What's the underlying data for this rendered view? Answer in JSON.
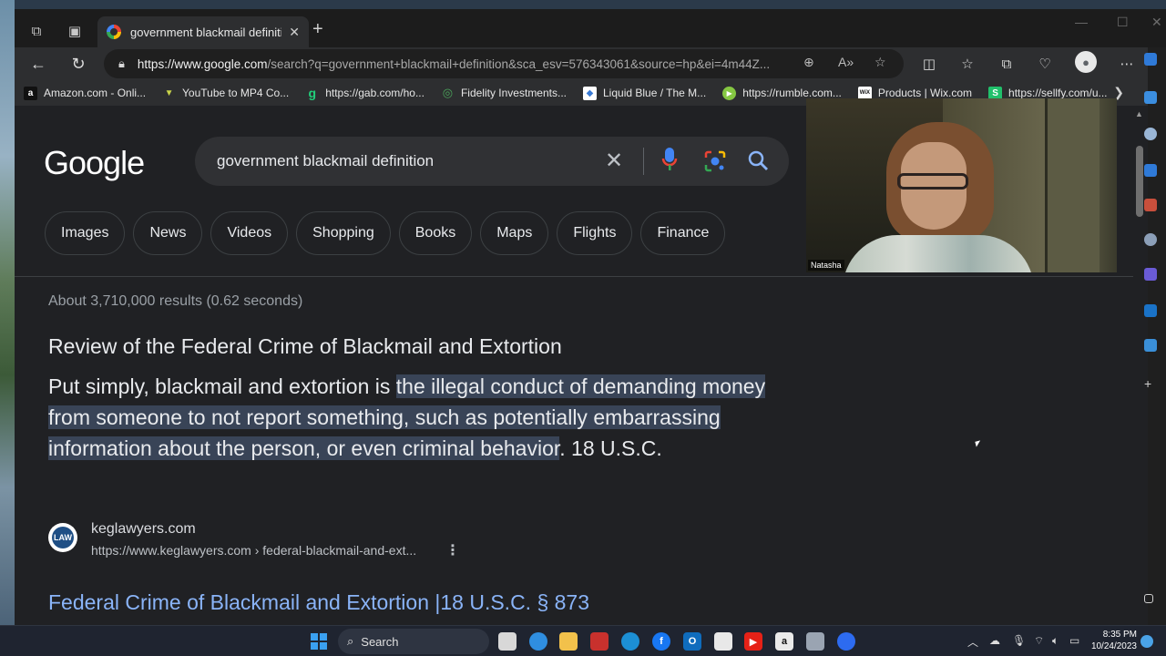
{
  "browser": {
    "tab_title": "government blackmail definition",
    "url_domain": "https://www.google.com",
    "url_rest": "/search?q=government+blackmail+definition&sca_esv=576343061&source=hp&ei=4m44Z..."
  },
  "bookmarks": [
    {
      "label": "Amazon.com - Onli...",
      "icon": "a",
      "color": "#ffffff"
    },
    {
      "label": "YouTube to MP4 Co...",
      "icon": "▼",
      "color": "#c9d44a"
    },
    {
      "label": "https://gab.com/ho...",
      "icon": "g",
      "color": "#21cf7a"
    },
    {
      "label": "Fidelity Investments...",
      "icon": "◎",
      "color": "#3b8a4a"
    },
    {
      "label": "Liquid Blue / The M...",
      "icon": "◆",
      "color": "#3a7bd5"
    },
    {
      "label": "https://rumble.com...",
      "icon": "▶",
      "color": "#85c742"
    },
    {
      "label": "Products | Wix.com",
      "icon": "WiX",
      "color": "#ffffff"
    },
    {
      "label": "https://sellfy.com/u...",
      "icon": "S",
      "color": "#21c06b"
    }
  ],
  "search": {
    "logo": "Google",
    "query": "government blackmail definition"
  },
  "chips": [
    "Images",
    "News",
    "Videos",
    "Shopping",
    "Books",
    "Maps",
    "Flights",
    "Finance"
  ],
  "results": {
    "stats": "About 3,710,000 results (0.62 seconds)",
    "featured_title": "Review of the Federal Crime of Blackmail and Extortion",
    "snippet_before": "Put simply, blackmail and extortion is ",
    "snippet_highlight": "the illegal conduct of demanding money from someone to not report something, such as potentially embarrassing information about the person, or even criminal behavior",
    "snippet_after": ". 18 U.S.C.",
    "source_logo": "LAW",
    "source_name": "keglawyers.com",
    "source_url": "https://www.keglawyers.com › federal-blackmail-and-ext...",
    "result_title": "Federal Crime of Blackmail and Extortion |18 U.S.C. § 873"
  },
  "webcam": {
    "participant_name": "Natasha"
  },
  "taskbar": {
    "search_label": "Search",
    "time": "8:35 PM",
    "date": "10/24/2023"
  }
}
